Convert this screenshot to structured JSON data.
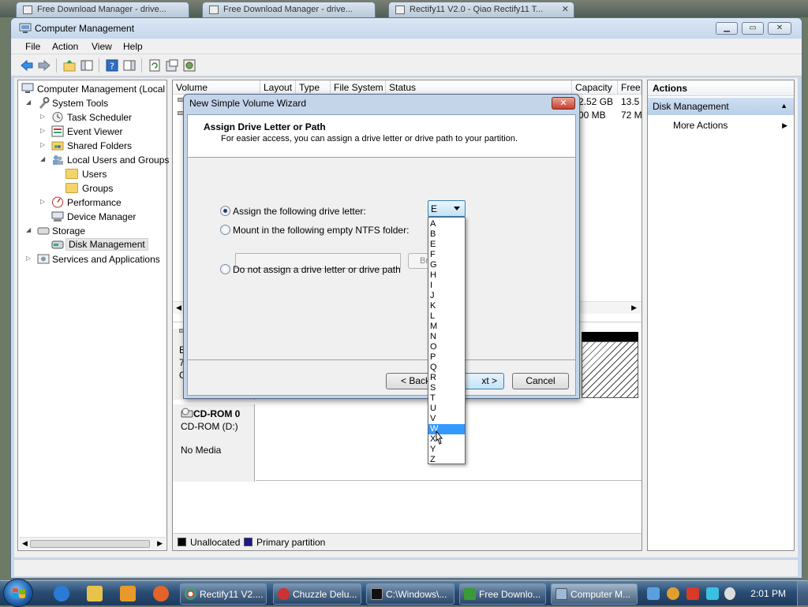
{
  "background_tabs": [
    {
      "label": "Free Download Manager - drive..."
    },
    {
      "label": "Free Download Manager - drive..."
    },
    {
      "label": "Rectify11 V2.0 - Qiao Rectify11 T..."
    }
  ],
  "window": {
    "title": "Computer Management"
  },
  "menu": [
    "File",
    "Action",
    "View",
    "Help"
  ],
  "tree": {
    "root": "Computer Management (Local",
    "system_tools": "System Tools",
    "task_scheduler": "Task Scheduler",
    "event_viewer": "Event Viewer",
    "shared_folders": "Shared Folders",
    "local_users": "Local Users and Groups",
    "users": "Users",
    "groups": "Groups",
    "performance": "Performance",
    "device_manager": "Device Manager",
    "storage": "Storage",
    "disk_management": "Disk Management",
    "services": "Services and Applications"
  },
  "volume_table": {
    "columns": [
      "Volume",
      "Layout",
      "Type",
      "File System",
      "Status",
      "Capacity",
      "Free"
    ],
    "rows": [
      {
        "capacity": "2.52 GB",
        "free": "13.5"
      },
      {
        "capacity": "00 MB",
        "free": "72 M"
      }
    ]
  },
  "disk_panel": {
    "partial_line1": "B",
    "partial_line2": "7",
    "partial_line3": "O",
    "cdrom_title": "CD-ROM 0",
    "cdrom_sub": "CD-ROM (D:)",
    "cdrom_status": "No Media"
  },
  "legend": {
    "unallocated": "Unallocated",
    "primary": "Primary partition",
    "unallocated_color": "#000000",
    "primary_color": "#1a1a8c"
  },
  "actions": {
    "header": "Actions",
    "section": "Disk Management",
    "more": "More Actions"
  },
  "wizard": {
    "title": "New Simple Volume Wizard",
    "close": "✕",
    "heading": "Assign Drive Letter or Path",
    "subheading": "For easier access, you can assign a drive letter or drive path to your partition.",
    "option_assign": "Assign the following drive letter:",
    "option_mount": "Mount in the following empty NTFS folder:",
    "option_none": "Do not assign a drive letter or drive path",
    "browse_partial": "Bro",
    "back": "< Back",
    "next_partial": "xt >",
    "cancel": "Cancel",
    "selected_letter": "E",
    "letters": [
      "A",
      "B",
      "E",
      "F",
      "G",
      "H",
      "I",
      "J",
      "K",
      "L",
      "M",
      "N",
      "O",
      "P",
      "Q",
      "R",
      "S",
      "T",
      "U",
      "V",
      "W",
      "X",
      "Y",
      "Z"
    ],
    "highlighted_letter": "W"
  },
  "taskbar": {
    "items": [
      {
        "label": "Rectify11 V2...."
      },
      {
        "label": "Chuzzle Delu..."
      },
      {
        "label": "C:\\Windows\\..."
      },
      {
        "label": "Free Downlo..."
      },
      {
        "label": "Computer M..."
      }
    ],
    "clock": "2:01 PM"
  },
  "colors": {
    "accent": "#3399ff",
    "taskbar": "#2a4d74"
  }
}
